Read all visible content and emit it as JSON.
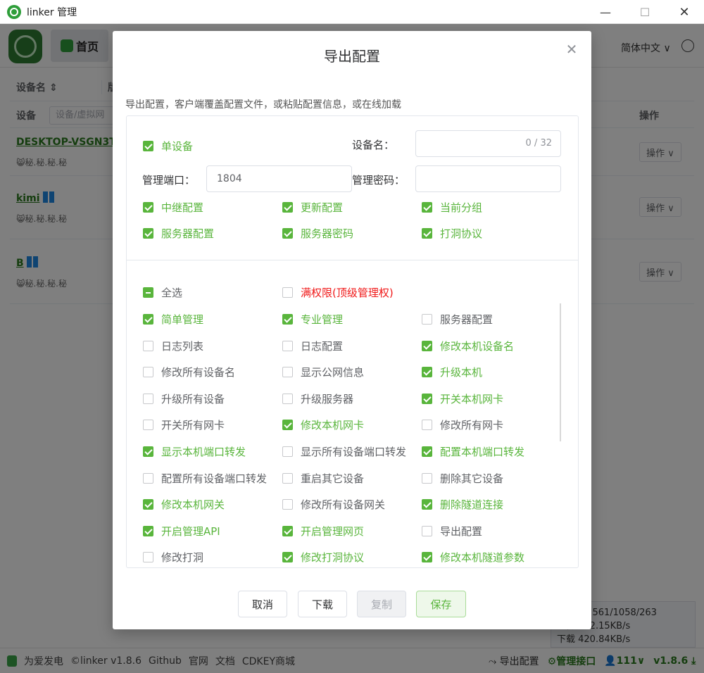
{
  "window": {
    "title": "linker 管理",
    "min": "—",
    "max": "☐",
    "close": "✕"
  },
  "header": {
    "home_label": "首页",
    "language": "简体中文 ∨"
  },
  "table": {
    "col_device_name": "设备名 ⇕",
    "col_version": "版",
    "filter_label": "设备",
    "filter_placeholder": "设备/虚拟网",
    "op_label": "操作",
    "rows": [
      {
        "name": "DESKTOP-VSGN3T3",
        "sub": "😸秘.秘.秘.秘",
        "op": "操作 ∨"
      },
      {
        "name": "kimi",
        "sub": "😸秘.秘.秘.秘",
        "op": "操作 ∨"
      },
      {
        "name": "B",
        "sub": "😸秘.秘.秘.秘",
        "op": "操作 ∨"
      }
    ]
  },
  "speed": {
    "line1": "0/384、561/1058/263",
    "line2": "上传 122.15KB/s",
    "line3": "下载 420.84KB/s"
  },
  "footer": {
    "links": [
      "为爱发电",
      "©linker v1.8.6",
      "Github",
      "官网",
      "文档",
      "CDKEY商城"
    ],
    "export": "导出配置",
    "mgmt": "管理接口",
    "users": "111∨",
    "version": "v1.8.6 ⤓"
  },
  "dialog": {
    "title": "导出配置",
    "close": "✕",
    "description": "导出配置，客户端覆盖配置文件，或粘贴配置信息，或在线加载",
    "single_device": "单设备",
    "device_name_label": "设备名：",
    "device_name_count": "0 / 32",
    "mgmt_port_label": "管理端口：",
    "mgmt_port_value": "1804",
    "mgmt_pwd_label": "管理密码：",
    "options": [
      {
        "label": "中继配置",
        "checked": true
      },
      {
        "label": "更新配置",
        "checked": true
      },
      {
        "label": "当前分组",
        "checked": true
      },
      {
        "label": "服务器配置",
        "checked": true
      },
      {
        "label": "服务器密码",
        "checked": true
      },
      {
        "label": "打洞协议",
        "checked": true
      }
    ],
    "select_all": "全选",
    "full_perm": "满权限(顶级管理权)",
    "perms": [
      {
        "label": "简单管理",
        "checked": true
      },
      {
        "label": "专业管理",
        "checked": true
      },
      {
        "label": "服务器配置",
        "checked": false
      },
      {
        "label": "日志列表",
        "checked": false
      },
      {
        "label": "日志配置",
        "checked": false
      },
      {
        "label": "修改本机设备名",
        "checked": true
      },
      {
        "label": "修改所有设备名",
        "checked": false
      },
      {
        "label": "显示公网信息",
        "checked": false
      },
      {
        "label": "升级本机",
        "checked": true
      },
      {
        "label": "升级所有设备",
        "checked": false
      },
      {
        "label": "升级服务器",
        "checked": false
      },
      {
        "label": "开关本机网卡",
        "checked": true
      },
      {
        "label": "开关所有网卡",
        "checked": false
      },
      {
        "label": "修改本机网卡",
        "checked": true
      },
      {
        "label": "修改所有网卡",
        "checked": false
      },
      {
        "label": "显示本机端口转发",
        "checked": true
      },
      {
        "label": "显示所有设备端口转发",
        "checked": false
      },
      {
        "label": "配置本机端口转发",
        "checked": true
      },
      {
        "label": "配置所有设备端口转发",
        "checked": false
      },
      {
        "label": "重启其它设备",
        "checked": false
      },
      {
        "label": "删除其它设备",
        "checked": false
      },
      {
        "label": "修改本机网关",
        "checked": true
      },
      {
        "label": "修改所有设备网关",
        "checked": false
      },
      {
        "label": "删除隧道连接",
        "checked": true
      },
      {
        "label": "开启管理API",
        "checked": true
      },
      {
        "label": "开启管理网页",
        "checked": true
      },
      {
        "label": "导出配置",
        "checked": false
      },
      {
        "label": "修改打洞",
        "checked": false
      },
      {
        "label": "修改打洞协议",
        "checked": true
      },
      {
        "label": "修改本机隧道参数",
        "checked": true
      }
    ],
    "buttons": {
      "cancel": "取消",
      "download": "下载",
      "copy": "复制",
      "save": "保存"
    }
  },
  "colors": {
    "accent": "#59b53c",
    "danger": "#f01818",
    "link": "#2b7a1e"
  }
}
